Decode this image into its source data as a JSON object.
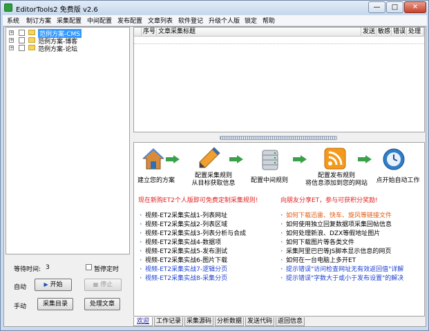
{
  "window": {
    "title": "EditorTools2 免费版 v2.6"
  },
  "menu": [
    "系统",
    "制订方案",
    "采集配置",
    "中间配置",
    "发布配置",
    "文章列表",
    "软件登记",
    "升级个人版",
    "锁定",
    "帮助"
  ],
  "tree": [
    {
      "label": "范例方案-CMS",
      "selected": true
    },
    {
      "label": "范例方案-博客",
      "selected": false
    },
    {
      "label": "范例方案-论坛",
      "selected": false
    }
  ],
  "left": {
    "wait_label": "等待时间:",
    "wait_value": "3",
    "pause_label": "暂停定时",
    "auto_label": "自动",
    "start_label": "开始",
    "stop_label": "停止",
    "manual_label": "手动",
    "collect_catalog_label": "采集目录",
    "process_article_label": "处理文章"
  },
  "grid": {
    "columns": [
      "序号",
      "文章采集标题",
      "发送",
      "敏感",
      "错误",
      "处理"
    ]
  },
  "flow": {
    "steps": [
      "建立您的方案",
      "配置采集规则\n从目标获取信息",
      "配置中间规则",
      "配置发布规则\n将信息添加到您的网站",
      "点开始自动工作"
    ],
    "promo_left": "现在新购ET2个人版即可免费定制采集规则!",
    "promo_right": "向朋友分享ET，参与可获积分奖励!"
  },
  "links_left": [
    {
      "text": "视频-ET2采集实战1-列表网址",
      "color": "#000000"
    },
    {
      "text": "视频-ET2采集实战2-列表区域",
      "color": "#000000"
    },
    {
      "text": "视频-ET2采集实战3-列表分析与合成",
      "color": "#000000"
    },
    {
      "text": "视频-ET2采集实战4-数据项",
      "color": "#000000"
    },
    {
      "text": "视频-ET2采集实战5-发布测试",
      "color": "#000000"
    },
    {
      "text": "视频-ET2采集实战6-图片下载",
      "color": "#000000"
    },
    {
      "text": "视频-ET2采集实战7-逻辑分页",
      "color": "#1a3fcf"
    },
    {
      "text": "视频-ET2采集实战8-采集分页",
      "color": "#1a3fcf"
    }
  ],
  "links_right": [
    {
      "text": "如何下载迅雷、快车、旋风等链接文件",
      "color": "#e05a10"
    },
    {
      "text": "如何使用独立回复数据项采集回帖信息",
      "color": "#000000"
    },
    {
      "text": "如何处理新浪、DZX等假地址图片",
      "color": "#000000"
    },
    {
      "text": "如何下载图片等各类文件",
      "color": "#000000"
    },
    {
      "text": "采集阿里巴巴等JS脚本显示信息的网页",
      "color": "#000000"
    },
    {
      "text": "如何在一台电脑上多开ET",
      "color": "#000000"
    },
    {
      "text": "提示错误\"访问检查网址无有效返回值\"详解",
      "color": "#1a3fcf"
    },
    {
      "text": "提示错误\"字数大于或小于发布设置\"的解决",
      "color": "#1a3fcf"
    }
  ],
  "tabs": [
    "欢迎",
    "工作记录",
    "采集源码",
    "分析数据",
    "发送代码",
    "返回信息"
  ],
  "icons": [
    "home-icon",
    "pencil-icon",
    "database-icon",
    "rss-icon",
    "clock-icon",
    "arrow-right-icon"
  ]
}
